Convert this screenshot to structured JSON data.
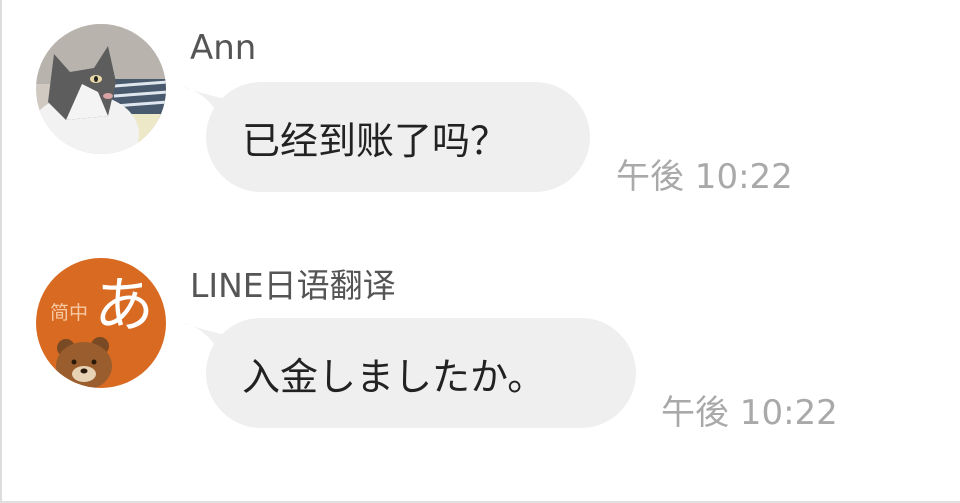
{
  "messages": [
    {
      "sender": "Ann",
      "text": "已经到账了吗？",
      "time": "午後 10:22",
      "avatar": "cat-photo"
    },
    {
      "sender": "LINE日语翻译",
      "text": "入金しましたか。",
      "time": "午後 10:22",
      "avatar": {
        "label": "简中",
        "kana": "あ",
        "icon": "bear-icon",
        "color": "#d86a22"
      }
    }
  ],
  "colors": {
    "bubble": "#efefef",
    "timestamp": "#a9a9a9",
    "sender": "#555555",
    "translator_avatar": "#d86a22"
  }
}
